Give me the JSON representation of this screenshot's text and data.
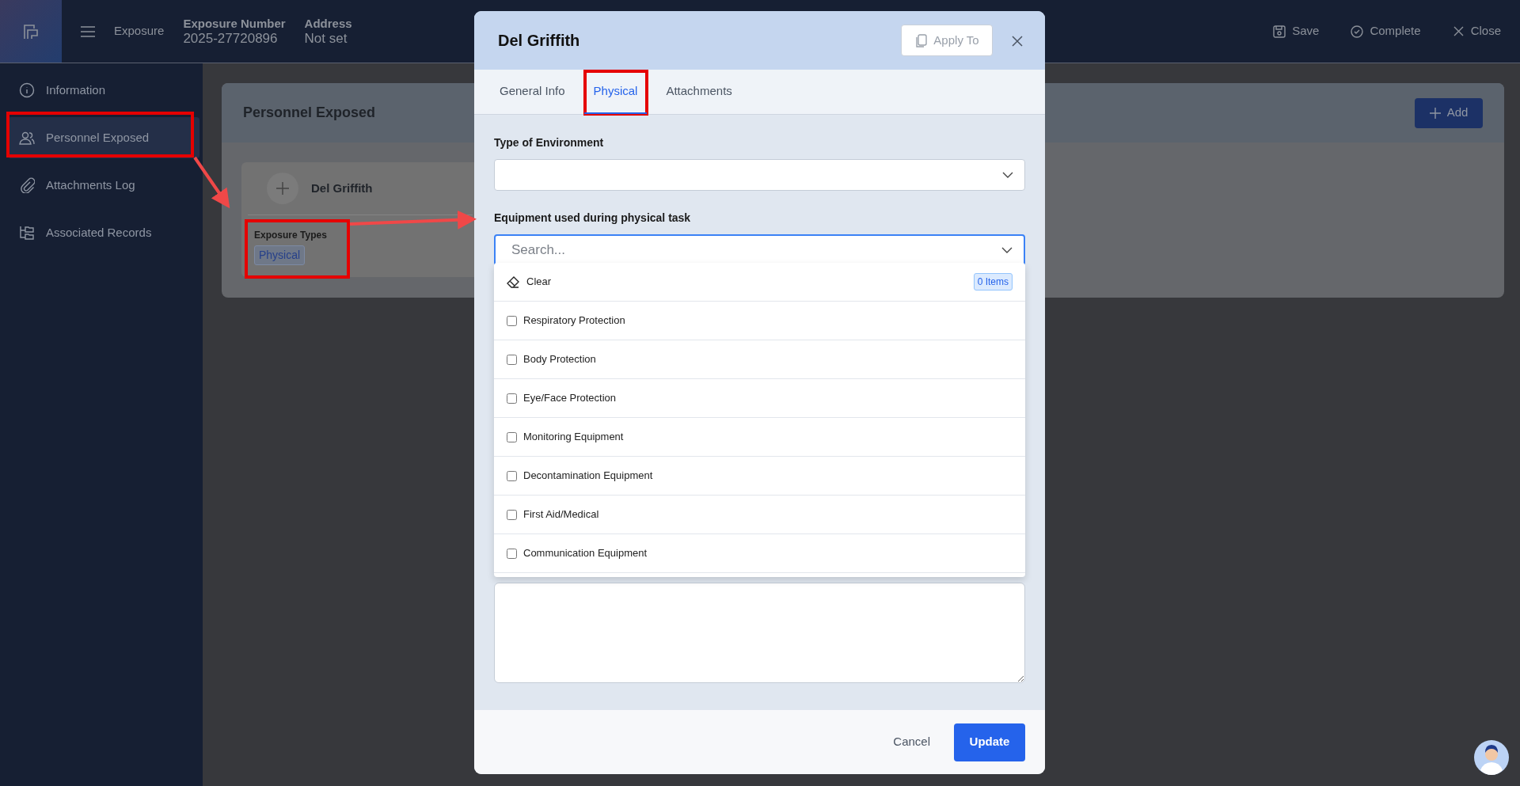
{
  "app": {
    "module": "Exposure",
    "fields": [
      {
        "label": "Exposure Number",
        "value": "2025-27720896"
      },
      {
        "label": "Address",
        "value": "Not set"
      }
    ]
  },
  "header_actions": [
    {
      "label": "Save"
    },
    {
      "label": "Complete"
    },
    {
      "label": "Close"
    }
  ],
  "sidebar": {
    "items": [
      {
        "label": "Information",
        "selected": false
      },
      {
        "label": "Personnel Exposed",
        "selected": true
      },
      {
        "label": "Attachments Log",
        "selected": false
      },
      {
        "label": "Associated Records",
        "selected": false
      }
    ]
  },
  "section": {
    "title": "Personnel Exposed",
    "add_button": "Add",
    "person": {
      "name": "Del Griffith",
      "types_label": "Exposure Types",
      "tags": [
        "Physical"
      ]
    }
  },
  "modal": {
    "title": "Del Griffith",
    "apply_button": "Apply To",
    "tabs": [
      {
        "label": "General Info",
        "selected": false
      },
      {
        "label": "Physical",
        "selected": true
      },
      {
        "label": "Attachments",
        "selected": false
      }
    ],
    "environment": {
      "label": "Type of Environment"
    },
    "equipment": {
      "label": "Equipment used during physical task",
      "placeholder": "Search...",
      "expanded": true,
      "clear": "Clear",
      "count": "0 Items",
      "options": [
        {
          "label": "Respiratory Protection",
          "checked": false
        },
        {
          "label": "Body Protection",
          "checked": false
        },
        {
          "label": "Eye/Face Protection",
          "checked": false
        },
        {
          "label": "Monitoring Equipment",
          "checked": false
        },
        {
          "label": "Decontamination Equipment",
          "checked": false
        },
        {
          "label": "First Aid/Medical",
          "checked": false
        },
        {
          "label": "Communication Equipment",
          "checked": false
        }
      ]
    },
    "cancel": "Cancel",
    "update": "Update"
  }
}
